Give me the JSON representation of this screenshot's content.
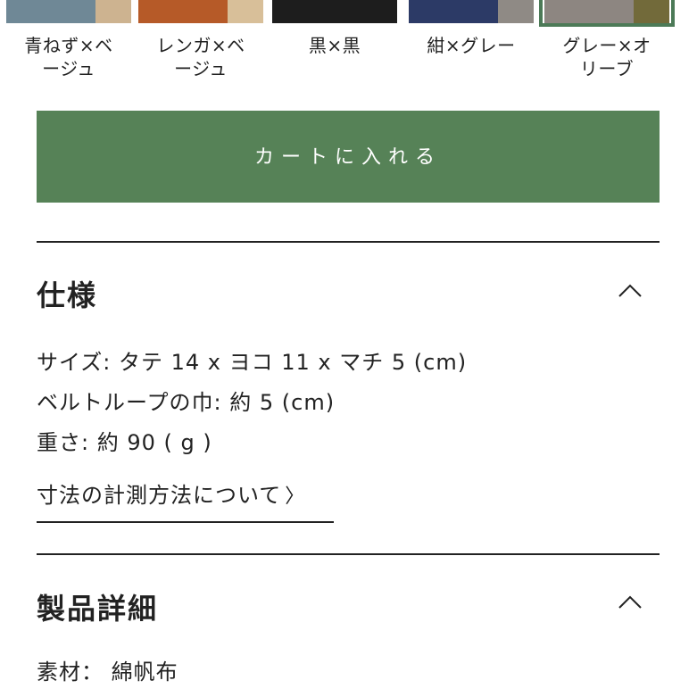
{
  "swatches": [
    {
      "label_line1": "青ねず×ベ",
      "label_line2": "ージュ",
      "main_color": "#6f8896",
      "sub_color": "#cdb390",
      "selected": false
    },
    {
      "label_line1": "レンガ×ベ",
      "label_line2": "ージュ",
      "main_color": "#b65a28",
      "sub_color": "#d8bf99",
      "selected": false
    },
    {
      "label_line1": "黒×黒",
      "label_line2": "",
      "main_color": "#1d1d1d",
      "sub_color": "#1d1d1d",
      "selected": false
    },
    {
      "label_line1": "紺×グレー",
      "label_line2": "",
      "main_color": "#2c3a66",
      "sub_color": "#8f8a85",
      "selected": false
    },
    {
      "label_line1": "グレー×オ",
      "label_line2": "リーブ",
      "main_color": "#8d8681",
      "sub_color": "#726a3a",
      "selected": true
    }
  ],
  "cart": {
    "label": "カートに入れる",
    "color": "#568257"
  },
  "specs": {
    "title": "仕様",
    "lines": [
      "サイズ: タテ 14 x ヨコ 11 x マチ 5 (cm)",
      "ベルトループの巾: 約 5 (cm)",
      "重さ: 約 90 ( g )"
    ],
    "link_label": "寸法の計測方法について",
    "link_arrow": "〉"
  },
  "details": {
    "title": "製品詳細",
    "material": "素材： 綿帆布"
  },
  "icons": {
    "collapse": "chevron-up-icon",
    "link_arrow": "chevron-right-icon"
  }
}
